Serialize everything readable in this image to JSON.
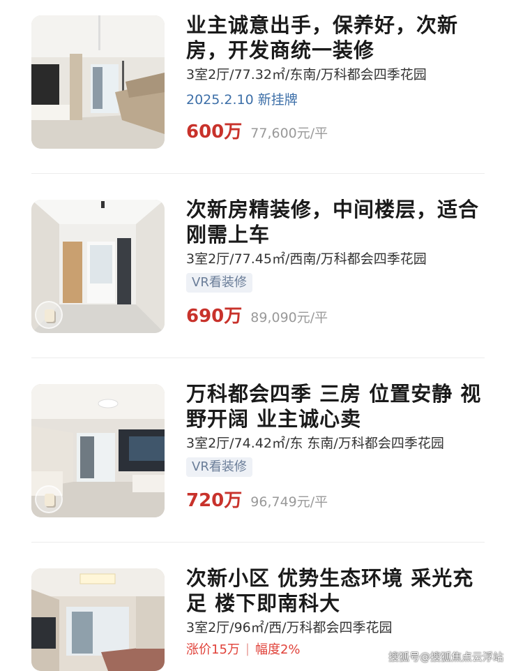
{
  "listings": [
    {
      "title": "业主诚意出手，保养好，次新房，开发商统一装修",
      "specs": "3室2厅/77.32㎡/东南/万科都会四季花园",
      "tag": "2025.2.10 新挂牌",
      "price": "600万",
      "unit_price": "77,600元/平"
    },
    {
      "title": "次新房精装修，中间楼层，适合刚需上车",
      "specs": "3室2厅/77.45㎡/西南/万科都会四季花园",
      "tag": "VR看装修",
      "price": "690万",
      "unit_price": "89,090元/平"
    },
    {
      "title": "万科都会四季 三房 位置安静 视野开阔 业主诚心卖",
      "specs": "3室2厅/74.42㎡/东 东南/万科都会四季花园",
      "tag": "VR看装修",
      "price": "720万",
      "unit_price": "96,749元/平"
    },
    {
      "title": "次新小区 优势生态环境 采光充足 楼下即南科大",
      "specs": "3室2厅/96㎡/西/万科都会四季花园",
      "rise": "涨价15万",
      "rise_sep": "|",
      "rise_pct": "幅度2%"
    }
  ],
  "watermark": "搜狐号@搜狐焦点云浮站",
  "colors": {
    "price": "#c8322b",
    "date_tag": "#3d6fa8",
    "vr_tag_text": "#6a7d98",
    "vr_tag_bg": "#eef1f6",
    "rise": "#e0423a"
  }
}
